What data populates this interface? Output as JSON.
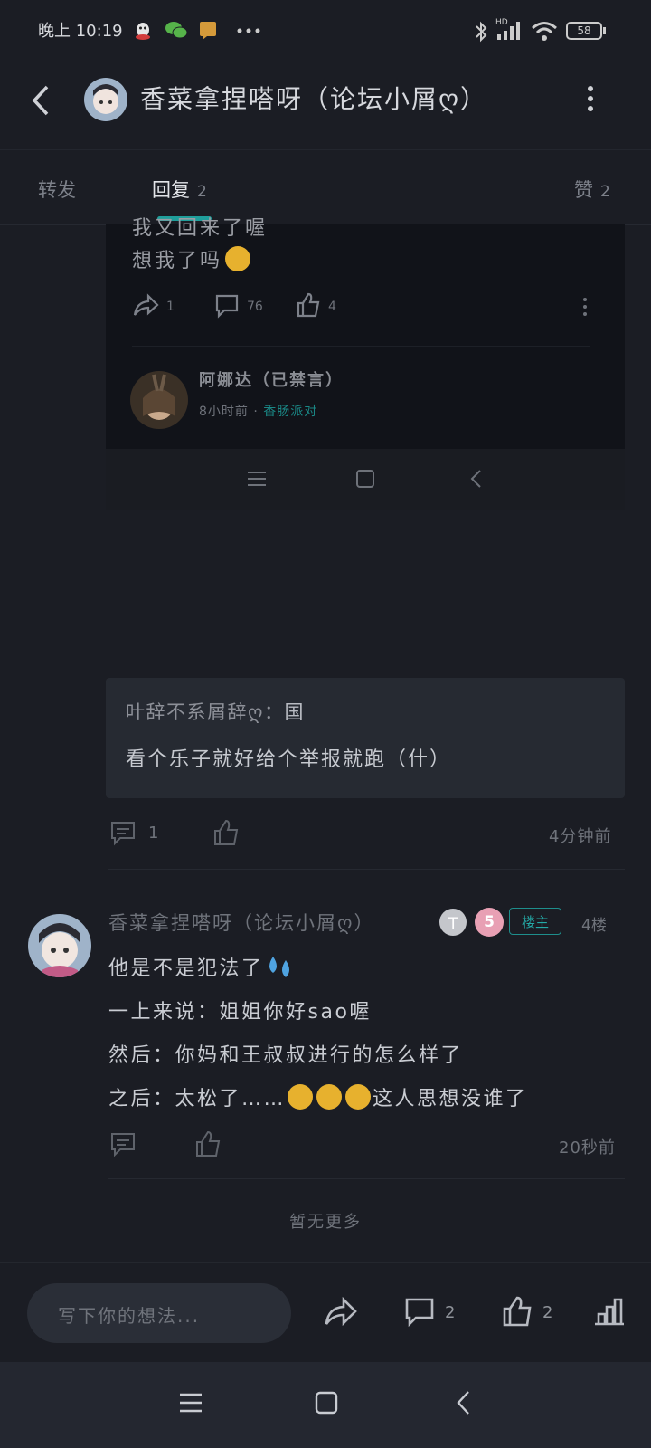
{
  "status_bar": {
    "time": "晚上 10:19",
    "battery": "58",
    "network_label": "HD"
  },
  "header": {
    "title": "香菜拿捏嗒呀（论坛小屑ღ）"
  },
  "tabs": [
    {
      "label": "转发",
      "count": ""
    },
    {
      "label": "回复",
      "count": "2"
    },
    {
      "label": "赞",
      "count": "2"
    }
  ],
  "embedded_post": {
    "line1": "我又回来了喔",
    "line2": "想我了吗",
    "share_count": "1",
    "comment_count": "76",
    "like_count": "4",
    "author": "阿娜达（已禁言）",
    "time": "8小时前",
    "dot": "·",
    "group": "香肠派对"
  },
  "quoted_reply": {
    "author": "叶辞不系屑辞ღ",
    "separator": "：",
    "emote": "国",
    "text": "看个乐子就好给个举报就跑（什）",
    "comment_count": "1",
    "time": "4分钟前"
  },
  "comment": {
    "author": "香菜拿捏嗒呀（论坛小屑ღ）",
    "level_badge": "5",
    "op_badge": "楼主",
    "floor": "4楼",
    "lines": [
      "他是不是犯法了",
      "一上来说：姐姐你好sao喔",
      "然后：你妈和王叔叔进行的怎么样了",
      "之后：太松了……",
      "这人思想没谁了"
    ],
    "time": "20秒前"
  },
  "footer_note": "暂无更多",
  "action_bar": {
    "placeholder": "写下你的想法...",
    "comment_count": "2",
    "like_count": "2"
  },
  "colors": {
    "background": "#1b1d24",
    "accent": "#1f9e9b",
    "bubble": "#262a32"
  }
}
